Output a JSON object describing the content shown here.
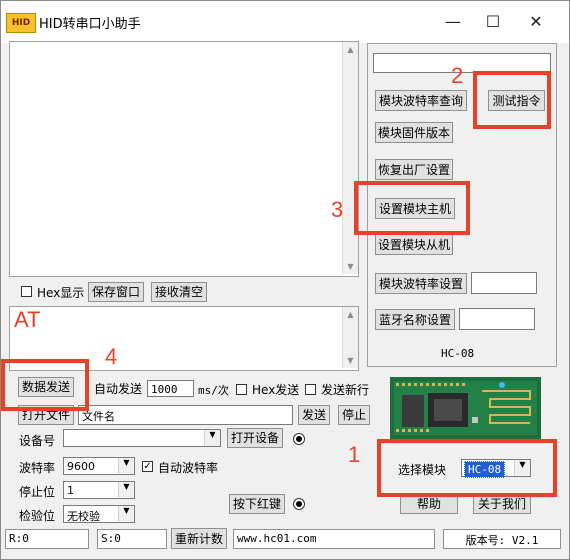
{
  "window": {
    "title": "HID转串口小助手",
    "app_icon": "HID",
    "minimize": "—",
    "maximize": "☐",
    "close": "✕"
  },
  "recv": {
    "hex_display": "Hex显示",
    "save_window": "保存窗口",
    "clear_recv": "接收清空"
  },
  "send": {
    "text": "AT",
    "send_data": "数据发送",
    "auto_send": "自动发送",
    "interval": "1000",
    "unit": "ms/次",
    "hex_send": "Hex发送",
    "send_newline": "发送新行"
  },
  "file": {
    "open_file": "打开文件",
    "file_name": "文件名",
    "send": "发送",
    "stop": "停止"
  },
  "serial": {
    "device_label": "设备号",
    "device_value": "",
    "open_device": "打开设备",
    "baud_label": "波特率",
    "baud_value": "9600",
    "auto_baud": "自动波特率",
    "stop_label": "停止位",
    "stop_value": "1",
    "parity_label": "检验位",
    "parity_value": "无校验",
    "press_red_key": "按下红键"
  },
  "module": {
    "top_field": "",
    "query_baud": "模块波特率查询",
    "test_cmd": "测试指令",
    "firmware": "模块固件版本",
    "factory_reset": "恢复出厂设置",
    "set_master": "设置模块主机",
    "set_slave": "设置模块从机",
    "baud_set": "模块波特率设置",
    "baud_set_value": "",
    "bt_name_set": "蓝牙名称设置",
    "bt_name_value": "",
    "model": "HC-08",
    "select_label": "选择模块",
    "select_value": "HC-08"
  },
  "footer": {
    "help": "帮助",
    "about": "关于我们",
    "rx": "R:0",
    "tx": "S:0",
    "reset_count": "重新计数",
    "website": "www.hc01.com",
    "version": "版本号: V2.1"
  },
  "annotations": {
    "n1": "1",
    "n2": "2",
    "n3": "3",
    "n4": "4"
  },
  "colors": {
    "highlight": "#e8412a",
    "send_text": "#e8412a",
    "combo_selected": "#1e5fd8"
  }
}
